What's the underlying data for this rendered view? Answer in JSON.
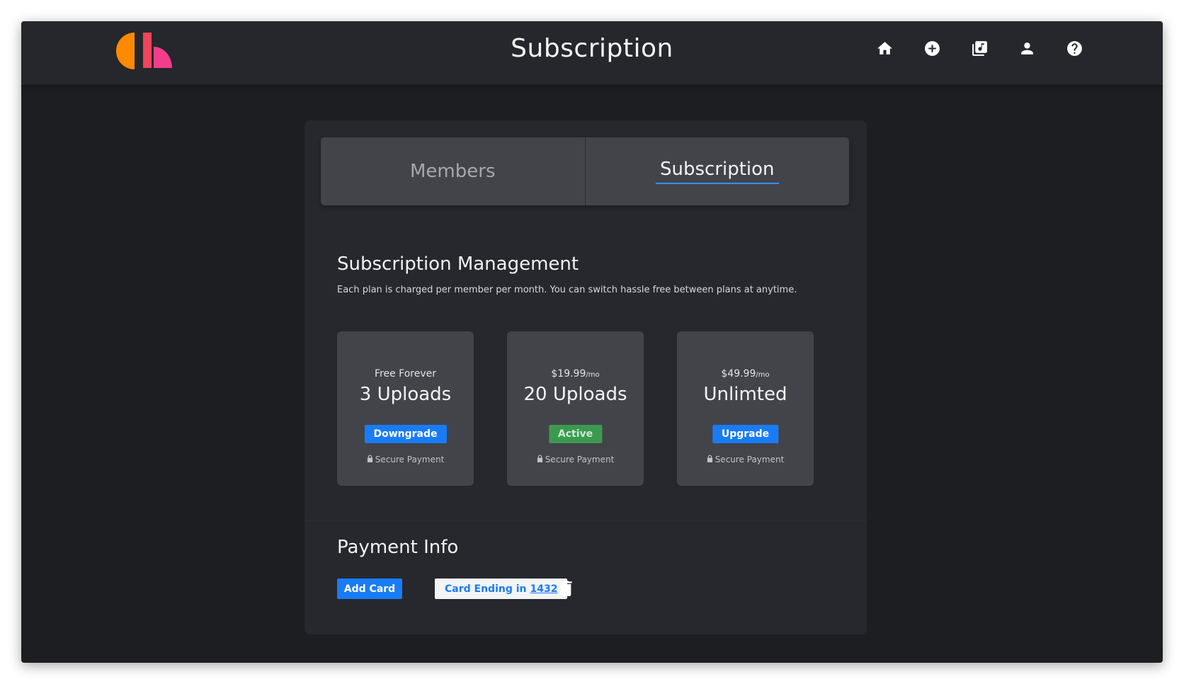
{
  "header": {
    "title": "Subscription",
    "brand_colors": {
      "orange": "#ff8a00",
      "red": "#f0455a",
      "pink": "#f23c8c"
    },
    "nav_icons": [
      "home-icon",
      "add-circle-icon",
      "library-music-icon",
      "person-icon",
      "help-icon"
    ]
  },
  "tabs": [
    {
      "label": "Members",
      "active": false
    },
    {
      "label": "Subscription",
      "active": true
    }
  ],
  "subscription": {
    "title": "Subscription Management",
    "description": "Each plan is charged per member per month. You can switch hassle free between plans at anytime.",
    "plans": [
      {
        "price": "Free Forever",
        "per": "",
        "name": "3 Uploads",
        "button": "Downgrade",
        "secure": "Secure Payment"
      },
      {
        "price": "$19.99",
        "per": "/mo",
        "name": "20 Uploads",
        "button": "Active",
        "secure": "Secure Payment"
      },
      {
        "price": "$49.99",
        "per": "/mo",
        "name": "Unlimted",
        "button": "Upgrade",
        "secure": "Secure Payment"
      }
    ]
  },
  "payment": {
    "title": "Payment Info",
    "add_card": "Add Card",
    "card_prefix": "Card Ending in",
    "card_last4": "1432"
  },
  "colors": {
    "accent": "#1a7cf5",
    "active_green": "#3c9a4f",
    "background": "#1d1e21",
    "panel": "#26282d",
    "card": "#42444a"
  }
}
